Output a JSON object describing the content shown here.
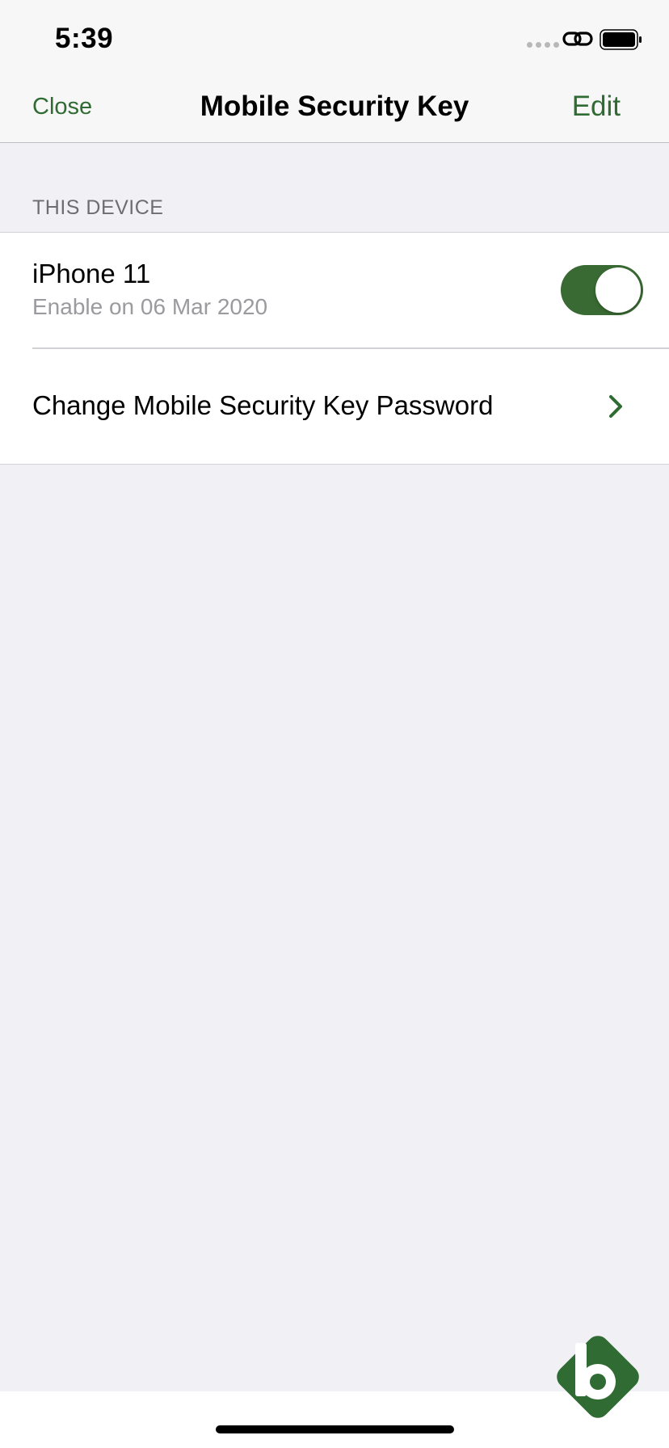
{
  "status_bar": {
    "time": "5:39",
    "icons": [
      "signal-dots-icon",
      "link-icon",
      "battery-icon"
    ]
  },
  "nav": {
    "close_label": "Close",
    "title": "Mobile Security Key",
    "edit_label": "Edit"
  },
  "section": {
    "header": "THIS DEVICE",
    "device": {
      "name": "iPhone 11",
      "subtitle": "Enable on 06 Mar 2020",
      "toggle_on": true
    },
    "password_row": {
      "label": "Change Mobile Security Key Password",
      "icon": "chevron-right-icon"
    }
  },
  "brand": {
    "logo_icon": "brand-logo-icon",
    "logo_letter": "b"
  },
  "colors": {
    "accent": "#2f6b32",
    "toggle_on": "#3a6a34",
    "background": "#f0f0f5",
    "secondary_text": "#9a9a9f"
  }
}
